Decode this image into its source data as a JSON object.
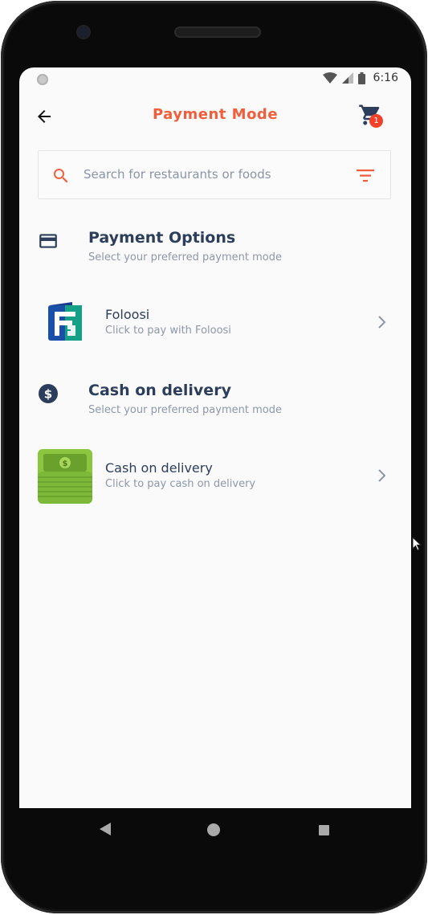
{
  "status_bar": {
    "time": "6:16"
  },
  "header": {
    "title": "Payment Mode",
    "cart_count": "1"
  },
  "search": {
    "placeholder": "Search for restaurants or foods"
  },
  "sections": [
    {
      "title": "Payment Options",
      "subtitle": "Select your preferred payment mode",
      "icon": "credit-card-icon",
      "options": [
        {
          "title": "Foloosi",
          "subtitle": "Click to pay with Foloosi",
          "icon": "foloosi-logo"
        }
      ]
    },
    {
      "title": "Cash on delivery",
      "subtitle": "Select your preferred payment mode",
      "icon": "dollar-circle-icon",
      "options": [
        {
          "title": "Cash on delivery",
          "subtitle": "Click to pay cash on delivery",
          "icon": "cash-stack-icon"
        }
      ]
    }
  ],
  "colors": {
    "accent": "#f25d3b",
    "heading": "#2c3e5c",
    "muted": "#8d97aa",
    "screen_bg": "#fafafa"
  }
}
